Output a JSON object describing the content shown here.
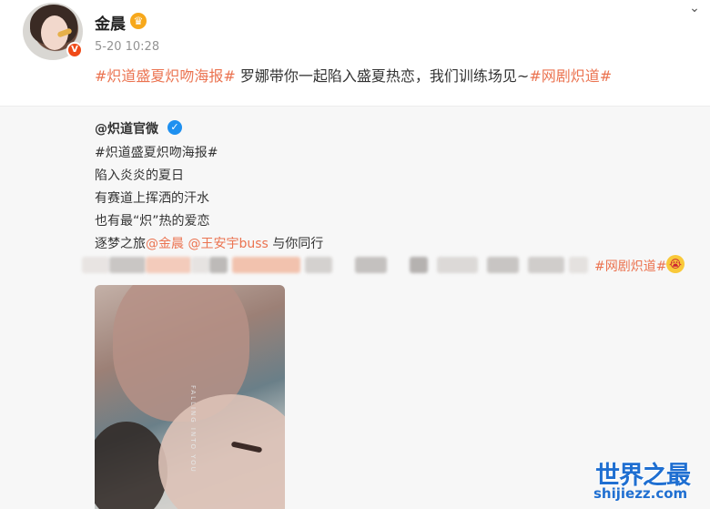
{
  "post": {
    "username": "金晨",
    "time": "5-20 10:28",
    "text_parts": [
      {
        "text": "#炽道盛夏炽吻海报#",
        "kind": "tag"
      },
      {
        "text": " 罗娜带你一起陷入盛夏热恋，我们训练场见~",
        "kind": "plain"
      },
      {
        "text": "#网剧炽道#",
        "kind": "tag"
      }
    ]
  },
  "repost": {
    "author": "@炽道官微",
    "hashtag": "#炽道盛夏炽吻海报#",
    "lines": [
      "陷入炎炎的夏日",
      "有赛道上挥洒的汗水",
      "也有最“炽”热的爱恋"
    ],
    "last_line": {
      "prefix": "逐梦之旅",
      "mention1": "@金晨",
      "mention2": "@王安宇buss",
      "suffix": " 与你同行"
    },
    "tail_tag": "#网剧炽道#",
    "poster_text": "FALLING INTO YOU"
  },
  "watermark": {
    "title": "世界之最",
    "url": "shijiezz.com"
  },
  "colors": {
    "accent": "#eb7350",
    "verified": "#1e90f0",
    "watermark": "#1f6fd1"
  },
  "icons": {
    "more": "chevron-down-icon",
    "verified": "verified-check-icon",
    "crown": "crown-icon",
    "emoji": "crying-emoji-icon"
  }
}
